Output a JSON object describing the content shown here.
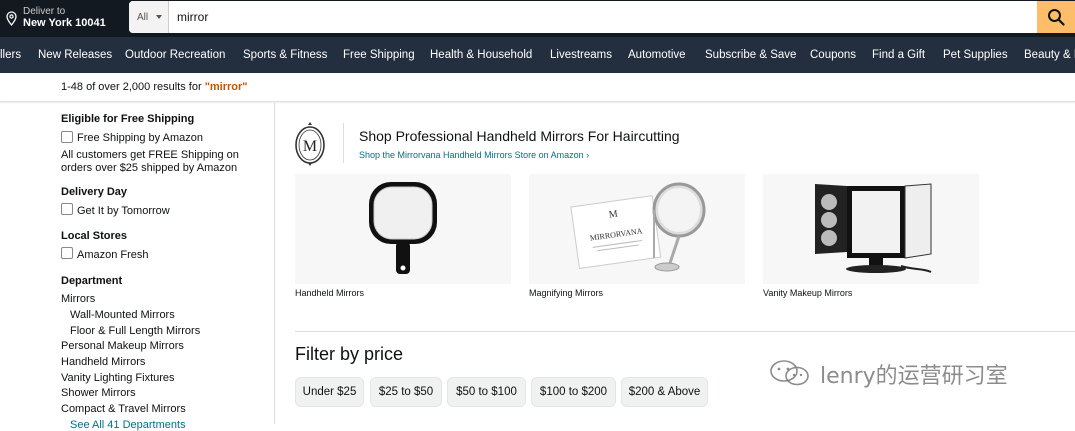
{
  "deliver": {
    "line1": "Deliver to",
    "line2": "New York 10041"
  },
  "search": {
    "category": "All",
    "query": "mirror"
  },
  "nav": [
    "llers",
    "New Releases",
    "Outdoor Recreation",
    "Sports & Fitness",
    "Free Shipping",
    "Health & Household",
    "Livestreams",
    "Automotive",
    "Subscribe & Save",
    "Coupons",
    "Find a Gift",
    "Pet Supplies",
    "Beauty & P"
  ],
  "results": {
    "prefix": "1-48 of over 2,000 results for ",
    "query": "\"mirror\""
  },
  "sidebar": {
    "free_shipping_heading": "Eligible for Free Shipping",
    "free_shipping_option": "Free Shipping by Amazon",
    "free_shipping_note": "All customers get FREE Shipping on orders over $25 shipped by Amazon",
    "delivery_heading": "Delivery Day",
    "delivery_option": "Get It by Tomorrow",
    "local_heading": "Local Stores",
    "local_option": "Amazon Fresh",
    "department_heading": "Department",
    "departments": [
      "Mirrors",
      "Wall-Mounted Mirrors",
      "Floor & Full Length Mirrors",
      "Personal Makeup Mirrors",
      "Handheld Mirrors",
      "Vanity Lighting Fixtures",
      "Shower Mirrors",
      "Compact & Travel Mirrors",
      "See All 41 Departments"
    ]
  },
  "brand": {
    "logo_letter": "M",
    "title": "Shop Professional Handheld Mirrors For Haircutting",
    "link": "Shop the Mirrorvana Handheld Mirrors Store on Amazon ›",
    "box_text": "MIRRORVANA"
  },
  "products": [
    "Handheld Mirrors",
    "Magnifying Mirrors",
    "Vanity Makeup Mirrors"
  ],
  "filter": {
    "title": "Filter by price",
    "ranges": [
      "Under $25",
      "$25 to $50",
      "$50 to $100",
      "$100 to $200",
      "$200 & Above"
    ]
  },
  "watermark": "lenry的运营研习室"
}
